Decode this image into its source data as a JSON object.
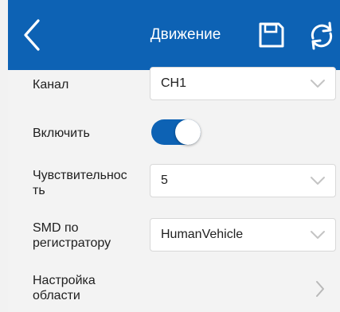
{
  "header": {
    "title": "Движение",
    "back_icon": "chevron-left-icon",
    "save_icon": "save-icon",
    "refresh_icon": "refresh-icon",
    "background": "#0d62b4"
  },
  "form": {
    "channel": {
      "label": "Канал",
      "value": "CH1"
    },
    "enable": {
      "label": "Включить",
      "on": true
    },
    "sensitivity": {
      "label_line1": "Чувствительнос",
      "label_line2": "ть",
      "value": "5"
    },
    "smd": {
      "label_line1": "SMD по",
      "label_line2": "регистратору",
      "value": "HumanVehicle"
    },
    "area": {
      "label_line1": "Настройка",
      "label_line2": "области"
    }
  },
  "colors": {
    "accent": "#0d62b4",
    "background": "#f3f3f3",
    "select_border": "#d8d8d8"
  }
}
